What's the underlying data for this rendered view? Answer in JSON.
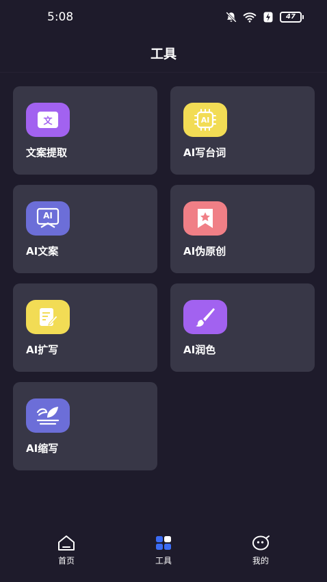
{
  "status_bar": {
    "time": "5:08",
    "battery": "47",
    "icons": [
      "mute-bell-icon",
      "wifi-icon",
      "charging-icon",
      "battery-icon"
    ]
  },
  "header": {
    "title": "工具"
  },
  "tools": [
    {
      "label": "文案提取",
      "icon": "text-extract-icon",
      "icon_text": "文",
      "color": "#a262f0"
    },
    {
      "label": "AI写台词",
      "icon": "ai-chip-icon",
      "icon_text": "AI",
      "color": "#f2dc55"
    },
    {
      "label": "AI文案",
      "icon": "ai-copywriting-icon",
      "icon_text": "AI",
      "color": "#6c6ed8"
    },
    {
      "label": "AI伪原创",
      "icon": "bookmark-star-icon",
      "color": "#f07f86"
    },
    {
      "label": "AI扩写",
      "icon": "note-pen-icon",
      "color": "#f2dc55"
    },
    {
      "label": "AI润色",
      "icon": "brush-icon",
      "color": "#a262f0"
    },
    {
      "label": "AI缩写",
      "icon": "feather-icon",
      "color": "#6c6ed8"
    }
  ],
  "tabbar": {
    "items": [
      {
        "label": "首页",
        "icon": "home-icon"
      },
      {
        "label": "工具",
        "icon": "tools-icon",
        "active": true
      },
      {
        "label": "我的",
        "icon": "profile-icon"
      }
    ],
    "active_color": "#3b6cf5"
  }
}
